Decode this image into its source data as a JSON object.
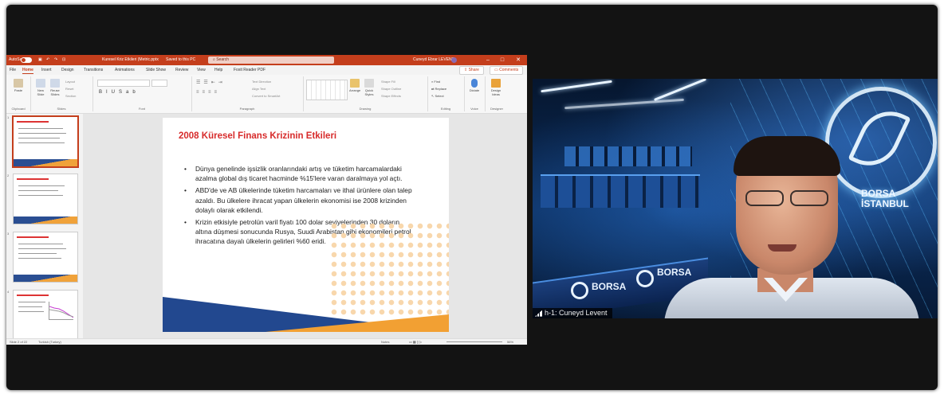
{
  "powerpoint": {
    "titlebar": {
      "autosave_label": "AutoSave",
      "doc_title": "Kuresel Kriz Etkileri (Metric.pptx",
      "saved_status": "Saved to this PC",
      "search_placeholder": "Search",
      "user_name": "Cuneyd Ebrar LEVENT",
      "user_initials": "CL",
      "accent": "#c43e1c"
    },
    "tabs": [
      "File",
      "Home",
      "Insert",
      "Design",
      "Transitions",
      "Animations",
      "Slide Show",
      "Review",
      "View",
      "Help",
      "Foxit Reader PDF"
    ],
    "active_tab": "Home",
    "share_label": "Share",
    "comments_label": "Comments",
    "ribbon": {
      "groups": [
        "Clipboard",
        "Slides",
        "Font",
        "Paragraph",
        "Drawing",
        "Editing",
        "Voice",
        "Designer"
      ],
      "paste_label": "Paste",
      "new_slide_label": "New Slide",
      "reuse_slides_label": "Reuse Slides",
      "layout_label": "Layout",
      "reset_label": "Reset",
      "section_label": "Section",
      "text_direction_label": "Text Direction",
      "align_text_label": "Align Text",
      "convert_smartart_label": "Convert to SmartArt",
      "arrange_label": "Arrange",
      "quick_styles_label": "Quick Styles",
      "shape_fill_label": "Shape Fill",
      "shape_outline_label": "Shape Outline",
      "shape_effects_label": "Shape Effects",
      "find_label": "Find",
      "replace_label": "Replace",
      "select_label": "Select",
      "dictate_label": "Dictate",
      "design_ideas_label": "Design Ideas"
    },
    "thumbnails": [
      "1",
      "2",
      "3",
      "4"
    ],
    "slide": {
      "title": "2008 Küresel Finans Krizinin Etkileri",
      "bullets": [
        "Dünya genelinde işsizlik oranlarındaki artış ve tüketim harcamalardaki azalma global dış ticaret hacminde %15'lere varan daralmaya yol açtı.",
        "ABD'de ve AB ülkelerinde tüketim harcamaları ve ithal ürünlere olan talep azaldı. Bu ülkelere ihracat yapan ülkelerin ekonomisi ise 2008 krizinden dolaylı olarak etkilendi.",
        "Krizin etkisiyle petrolün varil fiyatı 100 dolar seviyelerinden 30 doların altına düşmesi sonucunda Rusya, Suudi Arabistan gibi ekonomileri petrol ihracatına dayalı ülkelerin gelirleri %60 eridi."
      ],
      "title_color": "#d72b2b",
      "band_blue": "#22488f",
      "band_orange": "#f2a033"
    },
    "statusbar": {
      "slide_info": "Slide 2 of 22",
      "language": "Turkish (Turkey)",
      "notes_label": "Notes",
      "zoom": "56%"
    }
  },
  "webcam": {
    "participant_name": "h-1: Cuneyd Levent",
    "background_brand_line1": "BORSA",
    "background_brand_line2": "İSTANBUL",
    "stand_text_1": "BORSA",
    "stand_text_2": "BORSA"
  }
}
